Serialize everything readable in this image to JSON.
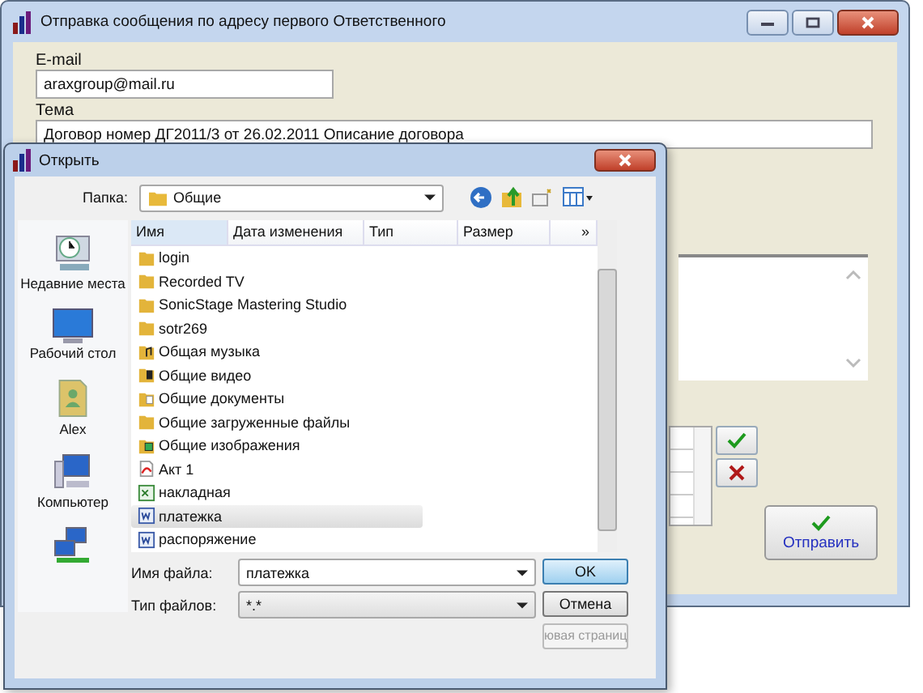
{
  "main_window": {
    "title": "Отправка сообщения по адресу первого Ответственного",
    "email_label": "E-mail",
    "email_value": "araxgroup@mail.ru",
    "subject_label": "Тема",
    "subject_value": "Договор номер ДГ2011/3 от 26.02.2011 Описание договора",
    "send_button": "Отправить"
  },
  "dialog": {
    "title": "Открыть",
    "folder_label": "Папка:",
    "folder_value": "Общие",
    "places": [
      {
        "kind": "recent",
        "label": "Недавние места"
      },
      {
        "kind": "desktop",
        "label": "Рабочий стол"
      },
      {
        "kind": "user",
        "label": "Alex"
      },
      {
        "kind": "computer",
        "label": "Компьютер"
      },
      {
        "kind": "network"
      }
    ],
    "columns": [
      "Имя",
      "Дата изменения",
      "Тип",
      "Размер",
      "»"
    ],
    "files": [
      {
        "name": "login",
        "kind": "folder",
        "selected": false
      },
      {
        "name": "Recorded TV",
        "kind": "folder",
        "selected": false
      },
      {
        "name": "SonicStage Mastering Studio",
        "kind": "folder",
        "selected": false
      },
      {
        "name": "sotr269",
        "kind": "folder",
        "selected": false
      },
      {
        "name": "Общая музыка",
        "kind": "music",
        "selected": false
      },
      {
        "name": "Общие видео",
        "kind": "video",
        "selected": false
      },
      {
        "name": "Общие документы",
        "kind": "docs",
        "selected": false
      },
      {
        "name": "Общие загруженные файлы",
        "kind": "folder",
        "selected": false
      },
      {
        "name": "Общие изображения",
        "kind": "images",
        "selected": false
      },
      {
        "name": "Акт 1",
        "kind": "pdf",
        "selected": false
      },
      {
        "name": "накладная",
        "kind": "excel",
        "selected": false
      },
      {
        "name": "платежка",
        "kind": "word",
        "selected": true
      },
      {
        "name": "распоряжение",
        "kind": "word",
        "selected": false
      }
    ],
    "filename_label": "Имя файла:",
    "filename_value": "платежка",
    "filetype_label": "Тип файлов:",
    "filetype_value": "*.*",
    "buttons": [
      {
        "label": "OK",
        "kind": "default"
      },
      {
        "label": "Отмена",
        "kind": "normal"
      },
      {
        "label": "ювая страниц",
        "kind": "disabled"
      }
    ]
  }
}
